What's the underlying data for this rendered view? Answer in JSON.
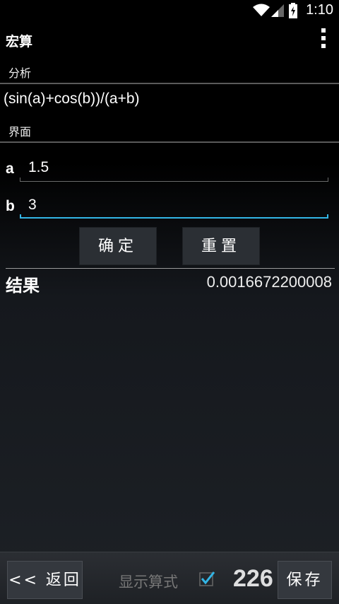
{
  "status": {
    "time": "1:10"
  },
  "app": {
    "title": "宏算"
  },
  "analysis": {
    "header": "分析",
    "formula": "(sin(a)+cos(b))/(a+b)"
  },
  "interface": {
    "header": "界面",
    "variables": [
      {
        "label": "a",
        "value": "1.5"
      },
      {
        "label": "b",
        "value": "3"
      }
    ],
    "confirm_label": "确定",
    "reset_label": "重置"
  },
  "result": {
    "label": "结果",
    "value": "0.0016672200008"
  },
  "bottom_bar": {
    "back_label": "<< 返回",
    "show_formula_label": "显示算式",
    "show_formula_checked": true,
    "save_label": "保存",
    "watermark": "226"
  },
  "colors": {
    "accent": "#33b5e5"
  }
}
